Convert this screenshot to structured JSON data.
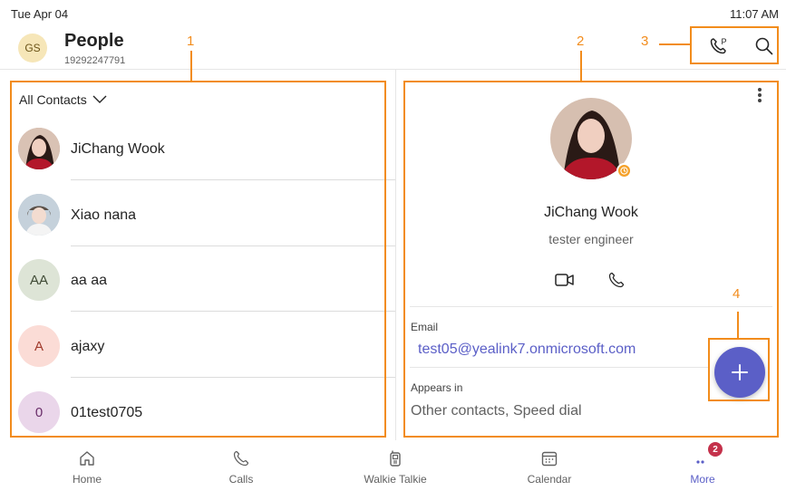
{
  "status": {
    "date": "Tue Apr 04",
    "time": "11:07 AM"
  },
  "header": {
    "avatar_initials": "GS",
    "title": "People",
    "subtitle": "19292247791"
  },
  "list": {
    "filter_label": "All Contacts",
    "contacts": [
      {
        "name": "JiChang Wook",
        "avatar": "photo-woman"
      },
      {
        "name": "Xiao nana",
        "avatar": "photo-person"
      },
      {
        "name": "aa aa",
        "initials": "AA",
        "avatar_bg": "#dde4d6",
        "avatar_fg": "#3f4a35"
      },
      {
        "name": "ajaxy",
        "initials": "A",
        "avatar_bg": "#fbdcd6",
        "avatar_fg": "#a03a2c"
      },
      {
        "name": "01test0705",
        "initials": "0",
        "avatar_bg": "#ead6ea",
        "avatar_fg": "#6a2e6a"
      }
    ]
  },
  "detail": {
    "name": "JiChang Wook",
    "job_title": "tester engineer",
    "email_label": "Email",
    "email_value": "test05@yealink7.onmicrosoft.com",
    "appears_label": "Appears in",
    "appears_value": "Other contacts, Speed dial"
  },
  "annotations": {
    "n1": "1",
    "n2": "2",
    "n3": "3",
    "n4": "4"
  },
  "nav": {
    "items": [
      {
        "label": "Home",
        "icon": "home-icon"
      },
      {
        "label": "Calls",
        "icon": "phone-icon"
      },
      {
        "label": "Walkie Talkie",
        "icon": "walkie-talkie-icon"
      },
      {
        "label": "Calendar",
        "icon": "calendar-icon"
      },
      {
        "label": "More",
        "icon": "more-icon",
        "badge": "2"
      }
    ]
  },
  "colors": {
    "accent": "#5b5fc7",
    "annotation": "#f28c1c",
    "presence_away": "#f5a12a",
    "badge": "#c4314b"
  }
}
